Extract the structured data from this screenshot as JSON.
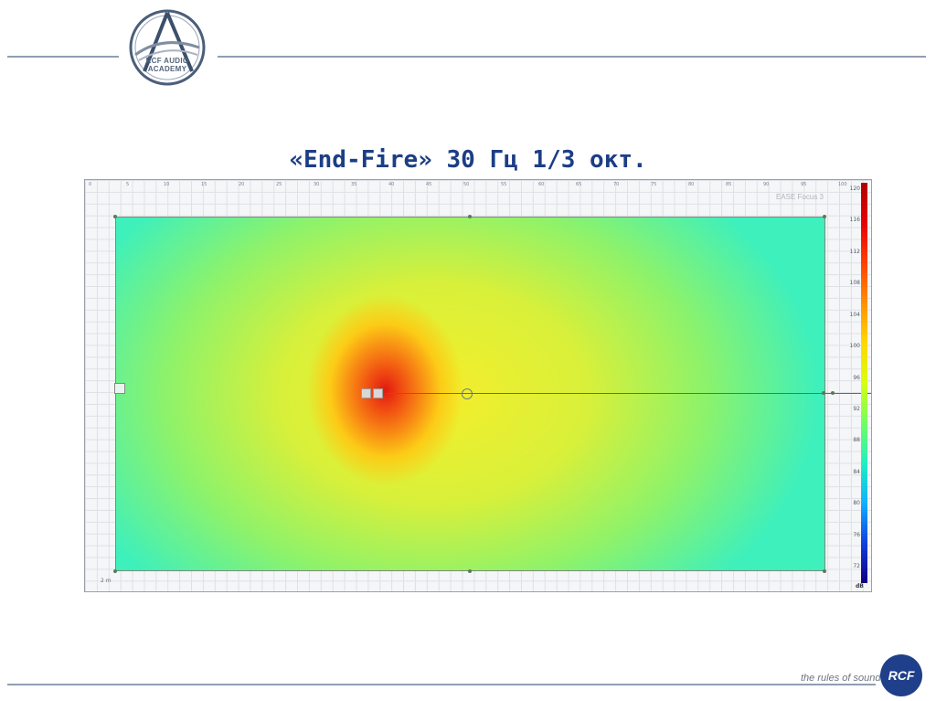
{
  "header": {
    "logo_line1": "RCF AUDIO",
    "logo_line2": "ACADEMY"
  },
  "slide": {
    "title": "«End-Fire» 30 Гц 1/3 окт."
  },
  "simulation": {
    "watermark": "EASE Focus 3",
    "ruler_top": [
      "0",
      "5",
      "10",
      "15",
      "20",
      "25",
      "30",
      "35",
      "40",
      "45",
      "50",
      "55",
      "60",
      "65",
      "70",
      "75",
      "80",
      "85",
      "90",
      "95",
      "100"
    ],
    "scale_label": "2 m",
    "colorbar": {
      "ticks": [
        "120",
        "116",
        "112",
        "108",
        "104",
        "100",
        "96",
        "92",
        "88",
        "84",
        "80",
        "76",
        "72"
      ],
      "unit": "dB"
    }
  },
  "footer": {
    "tagline": "the rules of sound",
    "brand": "RCF"
  },
  "colors": {
    "accent_blue": "#1c3e86",
    "rule_line": "#8f9eb3",
    "brand_blue": "#1f3f8a"
  }
}
